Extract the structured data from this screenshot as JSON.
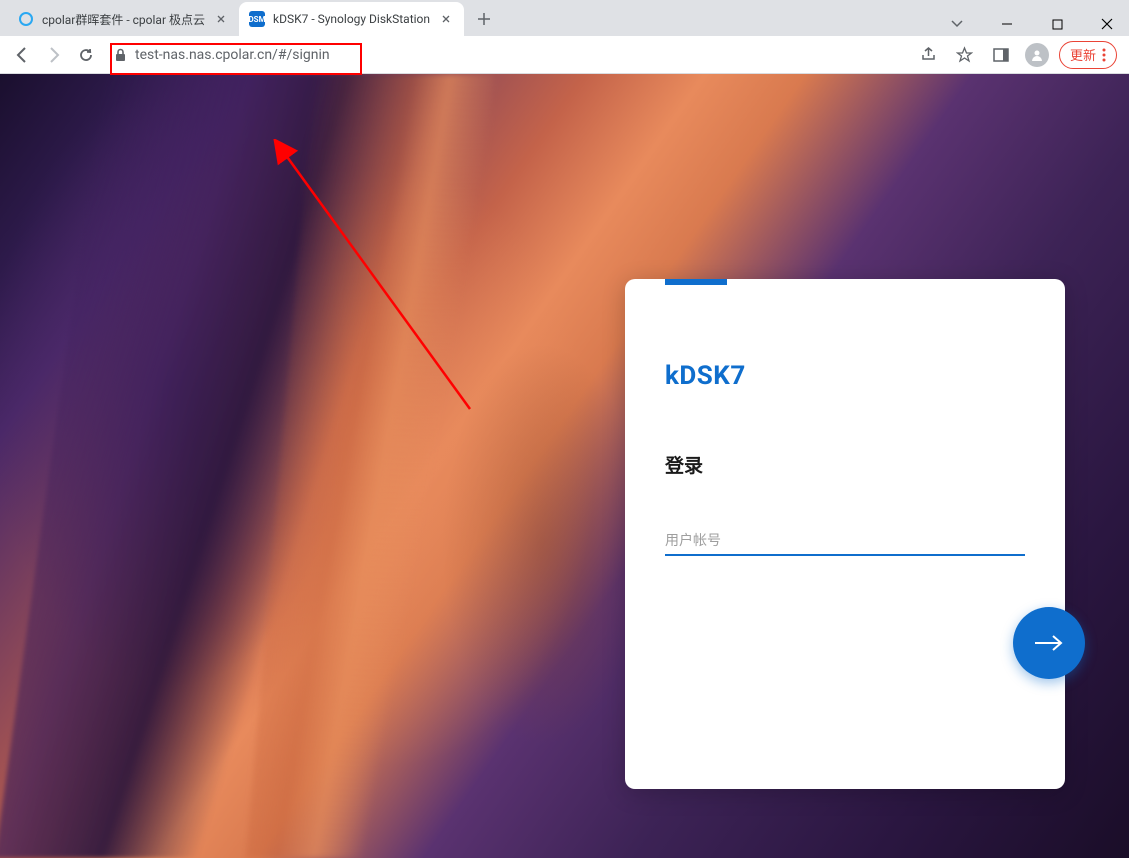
{
  "browser": {
    "tabs": [
      {
        "title": "cpolar群晖套件 - cpolar 极点云",
        "active": false
      },
      {
        "title": "kDSK7 - Synology DiskStation",
        "active": true
      }
    ],
    "url": "test-nas.nas.cpolar.cn/#/signin",
    "update_label": "更新"
  },
  "login": {
    "brand": "kDSK7",
    "title": "登录",
    "username_placeholder": "用户帐号"
  },
  "colors": {
    "accent": "#0f6ecd",
    "highlight": "#ff0000"
  }
}
